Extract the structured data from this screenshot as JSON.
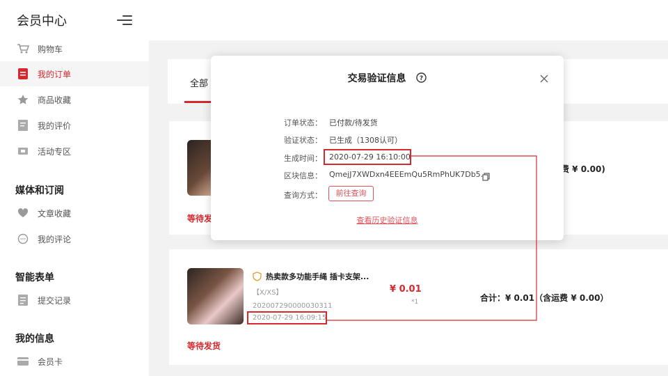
{
  "header": {
    "title": "会员中心"
  },
  "sidebar": {
    "items_top": [
      {
        "label": "购物车"
      },
      {
        "label": "我的订单"
      },
      {
        "label": "商品收藏"
      },
      {
        "label": "我的评价"
      },
      {
        "label": "活动专区"
      }
    ],
    "sections": [
      {
        "title": "媒体和订阅",
        "items": [
          {
            "label": "文章收藏"
          },
          {
            "label": "我的评论"
          }
        ]
      },
      {
        "title": "智能表单",
        "items": [
          {
            "label": "提交记录"
          }
        ]
      },
      {
        "title": "我的信息",
        "items": [
          {
            "label": "会员卡"
          }
        ]
      }
    ]
  },
  "orders_tab": {
    "label": "全部"
  },
  "order1": {
    "total_text": "费 ¥ 0.00)",
    "status": "等待发货"
  },
  "order2": {
    "title": "热卖款多功能手绳 插卡支架...",
    "variant": "【X/XS】",
    "price": "¥ 0.01",
    "qty": "*1",
    "order_no": "202007290000030311",
    "time": "2020-07-29 16:09:15",
    "total": "合计：¥ 0.01（含运费 ¥ 0.00）",
    "status": "等待发货"
  },
  "modal": {
    "title": "交易验证信息",
    "rows": [
      {
        "label": "订单状态：",
        "value": "已付款/待发货"
      },
      {
        "label": "验证状态：",
        "value": "已生成（1308认可）"
      },
      {
        "label": "生成时间：",
        "value": "2020-07-29 16:10:00"
      },
      {
        "label": "区块信息：",
        "value": "QmejJ7XWDxn4EEEmQu5RmPhUK7Db5.."
      },
      {
        "label": "查询方式：",
        "value": ""
      }
    ],
    "query_button": "前往查询",
    "history_link": "查看历史验证信息"
  },
  "colors": {
    "accent": "#d7282e",
    "annotation": "#d7282e"
  }
}
